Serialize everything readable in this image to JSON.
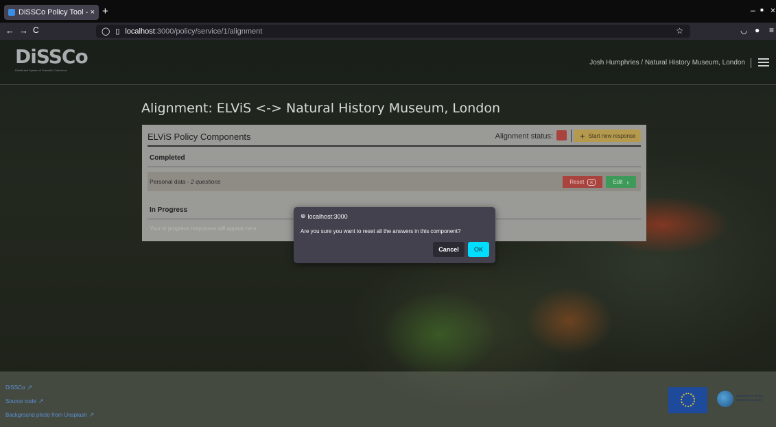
{
  "browser": {
    "tab_title": "DiSSCo Policy Tool - DiSS",
    "tab_close": "×",
    "new_tab": "+",
    "url_host": "localhost",
    "url_path": ":3000/policy/service/1/alignment",
    "back": "←",
    "forward": "→",
    "reload": "C",
    "window_controls": [
      "–",
      "■",
      "×"
    ]
  },
  "header": {
    "logo_text": "DiSSCo",
    "logo_subtitle": "Distributed System of Scientific Collections",
    "user": "Josh Humphries / Natural History Museum, London"
  },
  "page": {
    "title": "Alignment: ELViS <-> Natural History Museum, London"
  },
  "card": {
    "title": "ELViS Policy Components",
    "alignment_status_label": "Alignment status:",
    "status_color": "#a8433d",
    "start_button": "Start new response",
    "completed_heading": "Completed",
    "row_label": "Personal data",
    "row_separator": " - ",
    "row_count": "2 questions",
    "reset_button": "Reset",
    "edit_button": "Edit",
    "in_progress_heading": "In Progress",
    "in_progress_empty": "Your in progress responses will appear here"
  },
  "dialog": {
    "origin": "localhost:3000",
    "message": "Are you sure you want to reset all the answers in this component?",
    "cancel": "Cancel",
    "ok": "OK"
  },
  "footer": {
    "links": [
      "DiSSCo",
      "Source code",
      "Background photo from Unsplash"
    ],
    "eosc_line1": "EUROPEAN OPEN",
    "eosc_line2": "SCIENCE CLOUD"
  }
}
